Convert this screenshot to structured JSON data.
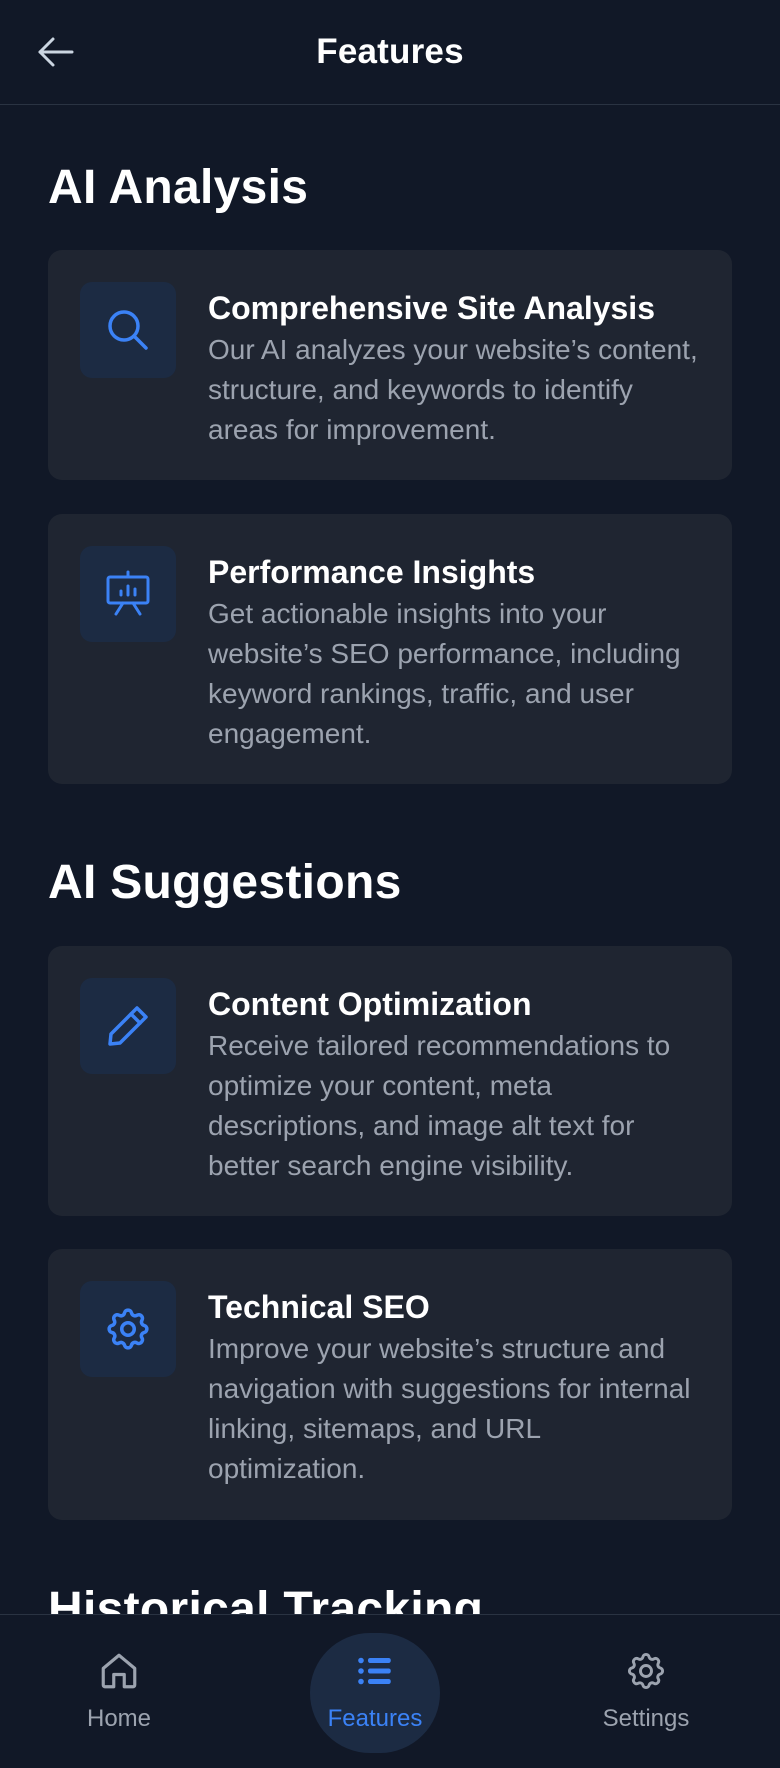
{
  "header": {
    "title": "Features",
    "back_icon": "arrow-left-icon"
  },
  "sections": [
    {
      "title": "AI Analysis",
      "cards": [
        {
          "icon": "search-icon",
          "title": "Comprehensive Site Analysis",
          "description": "Our AI analyzes your website’s content, structure, and keywords to identify areas for improvement."
        },
        {
          "icon": "presentation-chart-icon",
          "title": "Performance Insights",
          "description": "Get actionable insights into your website’s SEO performance, including keyword rankings, traffic, and user engagement."
        }
      ]
    },
    {
      "title": "AI Suggestions",
      "cards": [
        {
          "icon": "pencil-icon",
          "title": "Content Optimization",
          "description": "Receive tailored recommendations to optimize your content, meta descriptions, and image alt text for better search engine visibility."
        },
        {
          "icon": "gear-icon",
          "title": "Technical SEO",
          "description": "Improve your website’s structure and navigation with suggestions for internal linking, sitemaps, and URL optimization."
        }
      ]
    },
    {
      "title": "Historical Tracking"
    }
  ],
  "bottom_nav": {
    "items": [
      {
        "label": "Home",
        "icon": "home-icon"
      },
      {
        "label": "Features",
        "icon": "list-icon",
        "active": true
      },
      {
        "label": "Settings",
        "icon": "gear-icon"
      }
    ]
  },
  "colors": {
    "background": "#111827",
    "card": "#1f2531",
    "accent": "#3b82f6",
    "icon_bg": "#1c2b43",
    "muted_text": "#9ca3af"
  }
}
